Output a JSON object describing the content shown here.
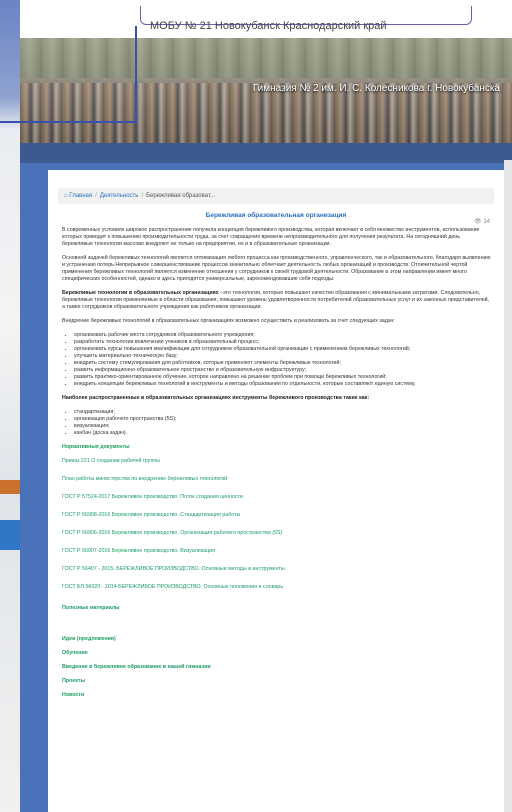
{
  "header": {
    "motto": "МОБУ № 21 Новокубанск Краснодарский край"
  },
  "banner": {
    "caption": "Гимназия № 2 им. И. С. Колесникова г. Новокубанска"
  },
  "breadcrumb": {
    "home": "Главная",
    "section": "Деятельность",
    "current": "Бережливая образоват..."
  },
  "views": "14",
  "article": {
    "title": "Бережливая образовательная организация",
    "p1": "В современных условиях широкое распространение получила концепция бережливого производства, которая включает в себя множество инструментов, использование которых приводит к повышению производительности труда, за счет сокращения времени непроизводительного для получения результата. На сегодняшний день бережливые технологии массово внедряют не только на предприятия, но и в образовательные организации.",
    "p2": "Основной задачей бережливых технологий является оптимизация любого процесса как производственного, управленческого, так и образовательного, благодаря выявлению и устранению потерь.Непрерывное совершенствование процессов значительно облегчает деятельность любых организаций и производств. Отличительной чертой применения бережливых технологий является изменение отношения у сотрудников к своей трудовой деятельности. Образование в этом направлении имеет много специфических особенностей, однако и здесь пригодятся универсальные, зарекомендовавшие себя подходы.",
    "p3_bold": "Бережливые технологии в образовательных организациях",
    "p3_rest": " –это технологии, которые повышают качество образования с минимальными затратами. Следовательно, бережливые технологии применяемые в области образования, повышают уровень удовлетворенности потребителей образовательных услуг и их законных представителей, а также сотрудников образовательного учреждения как работников организации.",
    "p4": "Внедрение бережливых технологий в образовательных организациях возможно осуществить и реализовать за счет следующих задач:",
    "tasks": [
      "организовать рабочие места сотрудников образовательного учреждения;",
      "разработать технологии вовлечения учеников в образовательный процесс;",
      "организовать курсы повышения квалификации для сотрудников образовательной организации с применением бережливых технологий;",
      "улучшить материально-техническую базу;",
      "внедрить систему стимулирования для работников, которые применяют элементы бережливых технологий;",
      "развить информационно-образовательное пространство и образовательную инфраструктуру;",
      "развить практико-ориентированное обучение, которое направлено на решение проблем при помощи бережливых технологий;",
      "внедрить концепции бережливых технологий в инструменты и методы образования по отдельности, которые составляют единую систему."
    ],
    "tools_heading": "Наиболее распространенные в образовательных организациях инструменты бережливого производства такие как:",
    "tools": [
      "стандартизация;",
      "организация рабочего пространства (5S);",
      "визуализация;",
      "канбан (доска задач)."
    ],
    "docs_heading": "Нормативные документы",
    "docs": [
      "Приказ 221 О создании рабочей группы",
      "План работы министерства по внедрению бережливых технологий",
      "ГОСТ Р 57524-2017 Бережливое производство. Поток создания ценности",
      "ГОСТ Р 56908-2016 Бережливое производство. Стандартизация работы",
      "ГОСТ Р 56906-2016 Бережливое производство. Организация рабочего пространства (5S)",
      "ГОСТ Р 56907-2016 Бережливое производство. Визуализация",
      "ГОСТ Р 56407 - 2015. БЕРЕЖЛИВОЕ ПРОИЗВОДСТВО. Основные методы и инструменты",
      "ГОСТ БЛ 56020 - 2014 БЕРЕЖЛИВОЕ ПРОИЗВОДСТВО. Основные положения и словарь"
    ],
    "useful": "Полезные материалы",
    "sections": [
      "Идеи (предложения)",
      "Обучение",
      "Введение в бережливое образование в нашей гимназии",
      "Проекты",
      "Новости"
    ]
  }
}
